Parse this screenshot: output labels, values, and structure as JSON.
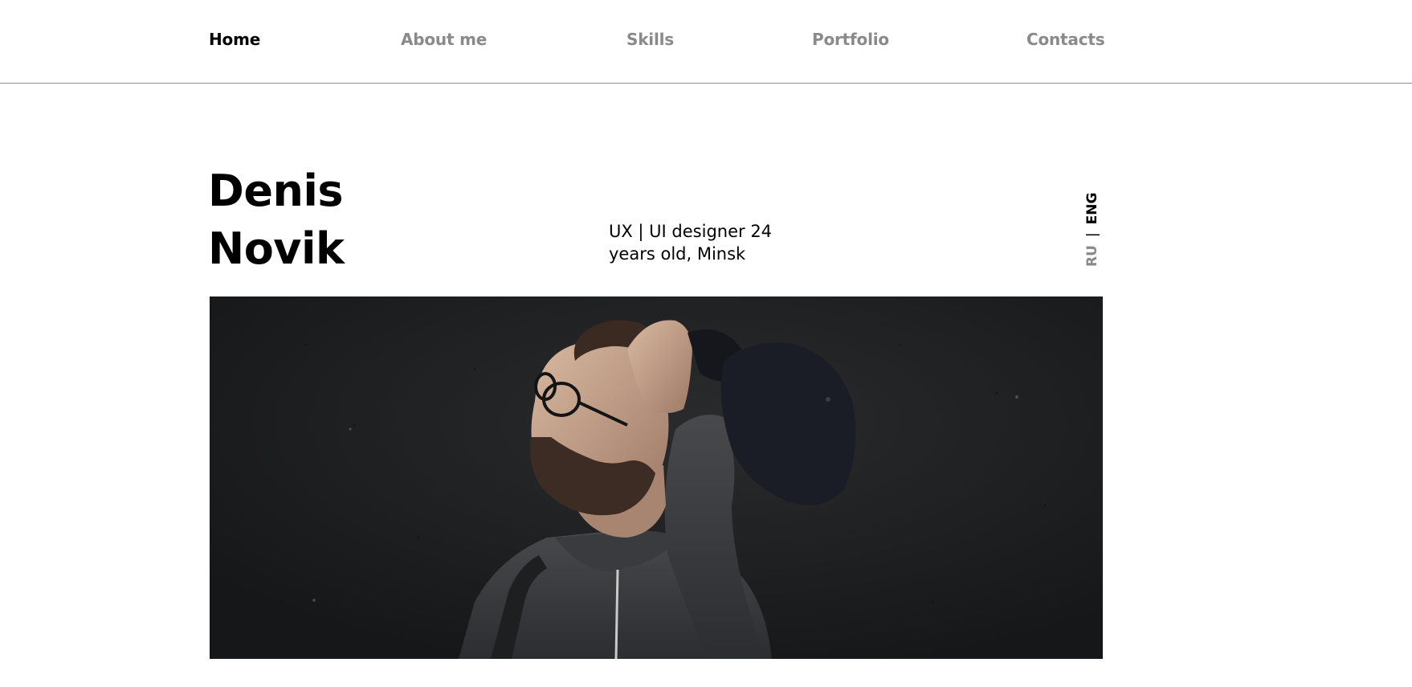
{
  "nav": {
    "items": [
      {
        "label": "Home",
        "active": true
      },
      {
        "label": "About me",
        "active": false
      },
      {
        "label": "Skills",
        "active": false
      },
      {
        "label": "Portfolio",
        "active": false
      },
      {
        "label": "Contacts",
        "active": false
      }
    ]
  },
  "hero": {
    "name_first": "Denis",
    "name_last": "Novik",
    "tagline_line1": "UX | UI designer 24",
    "tagline_line2": "years old, Minsk"
  },
  "language": {
    "options": [
      "RU",
      "ENG"
    ],
    "separator": "|",
    "selected": "ENG"
  },
  "colors": {
    "text": "#000000",
    "muted": "#8a8a8a",
    "divider": "#8e8e8e",
    "photo_background": "#1c1d1f"
  }
}
